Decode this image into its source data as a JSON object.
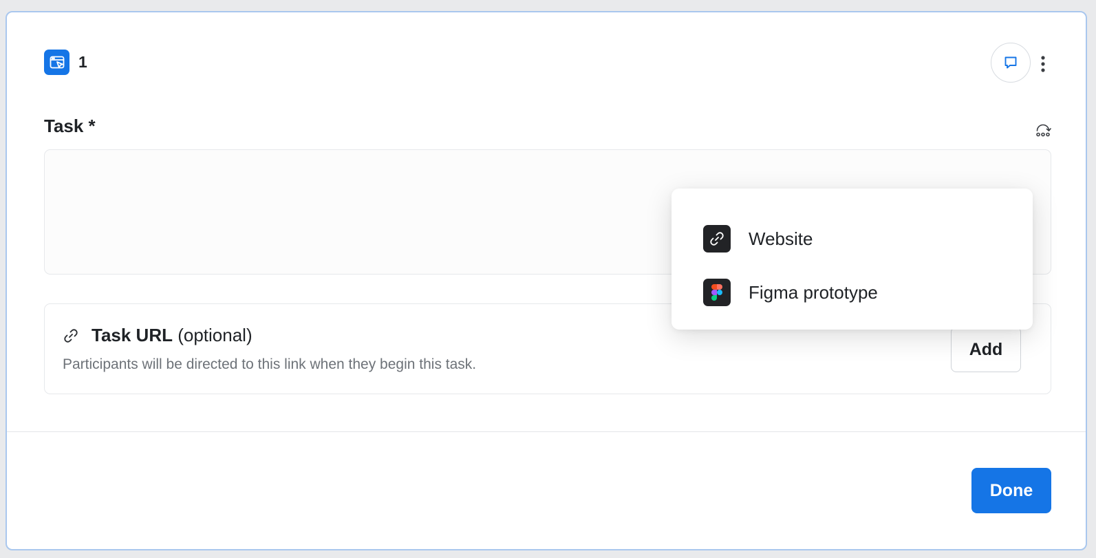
{
  "header": {
    "block_number": "1",
    "badge_icon": "browser-cursor-icon",
    "accent_color": "#1575e6"
  },
  "task": {
    "label": "Task *",
    "value": ""
  },
  "task_url": {
    "title_bold": "Task URL",
    "title_suffix": " (optional)",
    "description": "Participants will be directed to this link when they begin this task.",
    "add_label": "Add"
  },
  "dropdown": {
    "items": [
      {
        "label": "Website",
        "icon": "link-icon"
      },
      {
        "label": "Figma prototype",
        "icon": "figma-icon"
      }
    ]
  },
  "footer": {
    "done_label": "Done"
  }
}
